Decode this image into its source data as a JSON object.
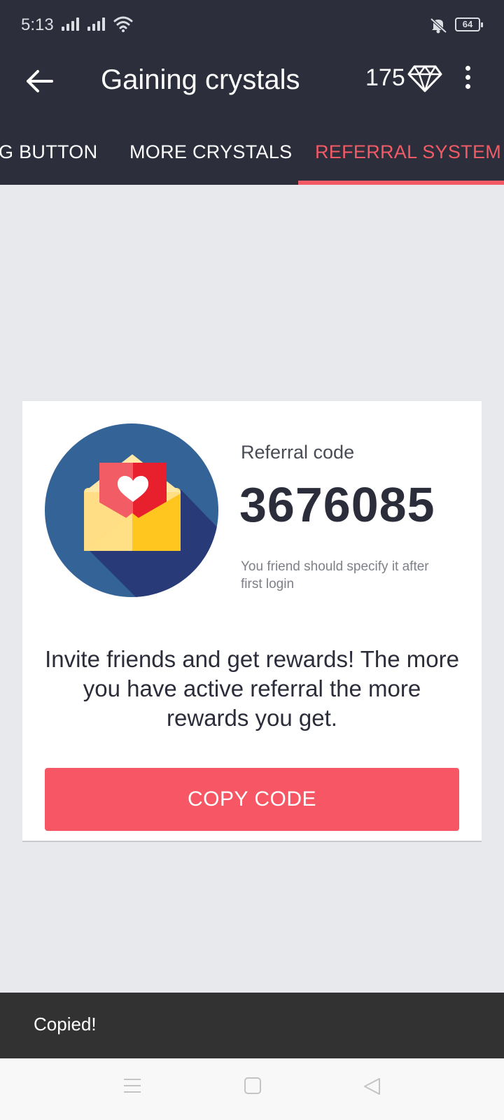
{
  "status_bar": {
    "time": "5:13",
    "battery": "64",
    "icons": [
      "signal-icon",
      "signal-icon",
      "wifi-icon",
      "bell-muted-icon",
      "battery-icon"
    ]
  },
  "app_bar": {
    "title": "Gaining crystals",
    "crystal_count": "175",
    "icons": [
      "back-arrow-icon",
      "diamond-icon",
      "more-vert-icon"
    ]
  },
  "tabs": [
    {
      "label": "G BUTTON",
      "active": false
    },
    {
      "label": "MORE CRYSTALS",
      "active": false
    },
    {
      "label": "REFERRAL SYSTEM",
      "active": true
    }
  ],
  "referral": {
    "label": "Referral code",
    "code": "3676085",
    "hint": "You friend should specify it after first login",
    "description": "Invite friends and get rewards! The more you have active referral the more rewards you get.",
    "button_label": "COPY CODE",
    "image_icon": "envelope-heart-icon"
  },
  "snackbar": {
    "message": "Copied!"
  },
  "nav_bar": {
    "icons": [
      "menu-icon",
      "home-square-icon",
      "back-triangle-icon"
    ]
  },
  "colors": {
    "header_bg": "#2c2e3b",
    "accent": "#f25a66",
    "button": "#f75765",
    "page_bg": "#e8e9ed",
    "snackbar_bg": "#323232"
  }
}
